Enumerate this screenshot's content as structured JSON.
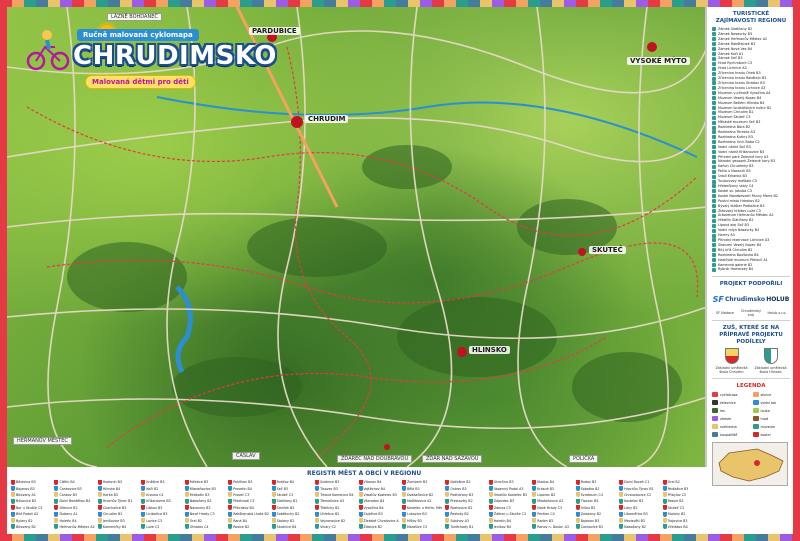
{
  "map": {
    "subtitle": "Ručně malovaná cyklomapa",
    "title": "CHRUDIMSKO",
    "tagline": "Malovaná dětmi pro děti",
    "cities": [
      {
        "name": "PARDUBICE"
      },
      {
        "name": "CHRUDIM"
      },
      {
        "name": "HLINSKO"
      },
      {
        "name": "SKUTEČ"
      },
      {
        "name": "VYSOKÉ MÝTO"
      }
    ],
    "edge_labels": [
      "LÁZNĚ BOHDANEČ",
      "HEŘMANŮV MĚSTEC",
      "ČÁSLAV",
      "ŽĎÁREC NAD DOUBRAVOU",
      "ŽĎÁR NAD SÁZAVOU",
      "POLIČKA"
    ]
  },
  "sidebar": {
    "poi_heading": "TURISTICKÉ ZAJÍMAVOSTI REGIONU",
    "poi": [
      "Zámek Slatiňany B2",
      "Zámek Nasavrky B3",
      "Zámek Heřmanův Městec A2",
      "Zámek Rabštejnek B3",
      "Zámek Nová Ves B4",
      "Zámek Kočí A1",
      "Zámek Seč B3",
      "Hrad Rychmburk C3",
      "Hrad Lichnice A3",
      "Zřícenina hradu Oheb B3",
      "Zřícenina hradu Rabštejn B3",
      "Zřícenina hradu Strádov B3",
      "Zřícenina hradu Lichnice A3",
      "Muzeum v přírodě Vysočina A4",
      "Muzeum Veselý Kopec B4",
      "Muzeum Betlém Hlinsko B4",
      "Muzeum loutkářských kultur B2",
      "Muzeum Chrudim B2",
      "Muzeum Skuteč C3",
      "Městské muzeum Seč B3",
      "Rozhledna Bára B2",
      "Rozhledna Terezka A3",
      "Rozhledna Kutiny B3",
      "Rozhledna Vrch Baba C2",
      "Vodní nádrž Seč B3",
      "Vodní nádrž Křižanovice B3",
      "Přírodní park Železné hory A3",
      "Národní geopark Železné hory B3",
      "Kaňon Chrudimky B3",
      "Peklo u Nasavrk B3",
      "Údolí Krkanka B3",
      "Toulovcovy maštale C3",
      "Hřebečkovy skály C4",
      "Kostel sv. Jakuba C3",
      "Kostel Nanebevzetí Panny Marie B2",
      "Poutní místo Hrbokov B2",
      "Bývalý klášter Podlažice B3",
      "Židovský hřbitov Luže C3",
      "Arboretum Heřmanův Městec A2",
      "Hřebčín Slatiňany B2",
      "Lipová alej Seč B3",
      "Vodní mlýn Nasavrky B3",
      "Hamry A3",
      "Přírodní rezervace Lichnice A3",
      "Skanzen Veselý Kopec B4",
      "Bílý kříž Chrudim B2",
      "Rozhledna Boušovka B4",
      "Hasičské muzeum Přelouč A1",
      "Kamenná galerie B2",
      "Rybník Hamerský B4"
    ],
    "support_heading": "PROJEKT PODPOŘILI",
    "sponsors": [
      "SF",
      "Chrudimsko",
      "HOLUB"
    ],
    "sponsor_captions": [
      "SF Nadace",
      "Chrudimský kraj",
      "Holub s.r.o."
    ],
    "helpers_heading": "ZUŠ, KTERÉ SE NA PŘÍPRAVĚ PROJEKTU PODÍLELY",
    "helper_crests": [
      "Základní umělecká škola Chrudim",
      "Základní umělecká škola Hlinsko"
    ],
    "legend_heading": "LEGENDA",
    "legend": [
      {
        "label": "cyklotrasa",
        "color": "#e63946"
      },
      {
        "label": "silnice",
        "color": "#f4a261"
      },
      {
        "label": "železnice",
        "color": "#333333"
      },
      {
        "label": "vodní tok",
        "color": "#2b8fd1"
      },
      {
        "label": "les",
        "color": "#356b24"
      },
      {
        "label": "louka",
        "color": "#9ccc4a"
      },
      {
        "label": "zámek",
        "color": "#9b5de5"
      },
      {
        "label": "hrad",
        "color": "#8d5524"
      },
      {
        "label": "rozhledna",
        "color": "#e9c46a"
      },
      {
        "label": "muzeum",
        "color": "#2a9d8f"
      },
      {
        "label": "koupaliště",
        "color": "#457b9d"
      },
      {
        "label": "kostel",
        "color": "#d62828"
      }
    ]
  },
  "register": {
    "title": "REGISTR MĚST A OBCÍ V REGIONU",
    "items": [
      "Běstvina B3",
      "Bojanov B3",
      "Bítovany A1",
      "Býkovice B3",
      "Bor u Skutče C3",
      "Bílé Podolí A2",
      "Bylany B2",
      "Bítovany B2",
      "Ctětín B4",
      "Čankovice B3",
      "Čankov B3",
      "Dolní Bezděkov B4",
      "Dřenice B2",
      "Dubany A1",
      "Holetín B4",
      "Heřmanův Městec A2",
      "Hodonín B3",
      "Hlinsko B4",
      "Horka B3",
      "Hrochův Týnec B1",
      "Chacholice B3",
      "Chrudim B2",
      "Jenišovice B3",
      "Kameničky B4",
      "Kněžice B3",
      "Kočí B2",
      "Krouna C4",
      "Křižanovice B3",
      "Libkov B3",
      "Licibořice B3",
      "Lozice C3",
      "Luže C3",
      "Miřetice B3",
      "Mladoňovice B3",
      "Mrákotín B3",
      "Nabočany B2",
      "Nasavrky B3",
      "Nové Hrady C3",
      "Orel B2",
      "Otradov C4",
      "Pokřikov B3",
      "Prosetín B4",
      "Proseč C3",
      "Předhradí C3",
      "Příkrakov B4",
      "Rabštejnská Lhota B2",
      "Raná B4",
      "Rosice B2",
      "Rváčov B4",
      "Seč B3",
      "Skuteč C3",
      "Slatiňany B2",
      "Smrček B3",
      "Sobětuchy B2",
      "Stolany B2",
      "Studnice B4",
      "Svídnice B3",
      "Tisovec B3",
      "Trhová Kamenice B4",
      "Třemošnice A3",
      "Třibřichy B2",
      "Úhřetice B2",
      "Vejvanovice B2",
      "Vinary C2",
      "Vítanov B4",
      "Vojtěchov B4",
      "Vrbatův Kostelec B3",
      "Všeradov B4",
      "Vysočina B4",
      "Zaječice B3",
      "Žlebské Chvalovice A3",
      "Ždánice B2",
      "Žumberk B3",
      "Bělá B3",
      "Dvakačovice B2",
      "Hošťálovice A2",
      "Kostelec u Heřm. Městce A2",
      "Lukavice B3",
      "Míčov B3",
      "Morašice C3",
      "Načešice B2",
      "Ostrov B3",
      "Podhořany B3",
      "Přestavlky B2",
      "Rozhovice B2",
      "Řestoky B2",
      "Sobínov A3",
      "Tuněchody B1",
      "Úherčice B3",
      "Vápenný Podol A3",
      "Vrbatův Kostelec B3",
      "Zájezdec B3",
      "Zderaz C3",
      "Žďárec u Skutče C3",
      "Holetín B4",
      "Jeníkov B4",
      "Kladno B4",
      "Krásné B3",
      "Lipovec B2",
      "Mladoňovice A3",
      "Nové Hrady C3",
      "Perálec C4",
      "Radim B3",
      "Ronov n. Doubr. A3",
      "Rudov B3",
      "Sobotka B2",
      "Svratouch C4",
      "Tisovec B4",
      "Vršov B3",
      "Zalažany B2",
      "Bojanov B3",
      "Čankovice B3",
      "Dolní Roveň C1",
      "Hrochův Týnec B1",
      "Chroustovice C2",
      "Kostelec B3",
      "Lány B2",
      "Liboměřice B3",
      "Mezisvětí B3",
      "Nabočany B2",
      "Orel B2",
      "Podlažice B3",
      "Přibylov C2",
      "Rosice B2",
      "Skuteč C3",
      "Stolany B2",
      "Trojovice B3",
      "Včelákov B4"
    ]
  }
}
